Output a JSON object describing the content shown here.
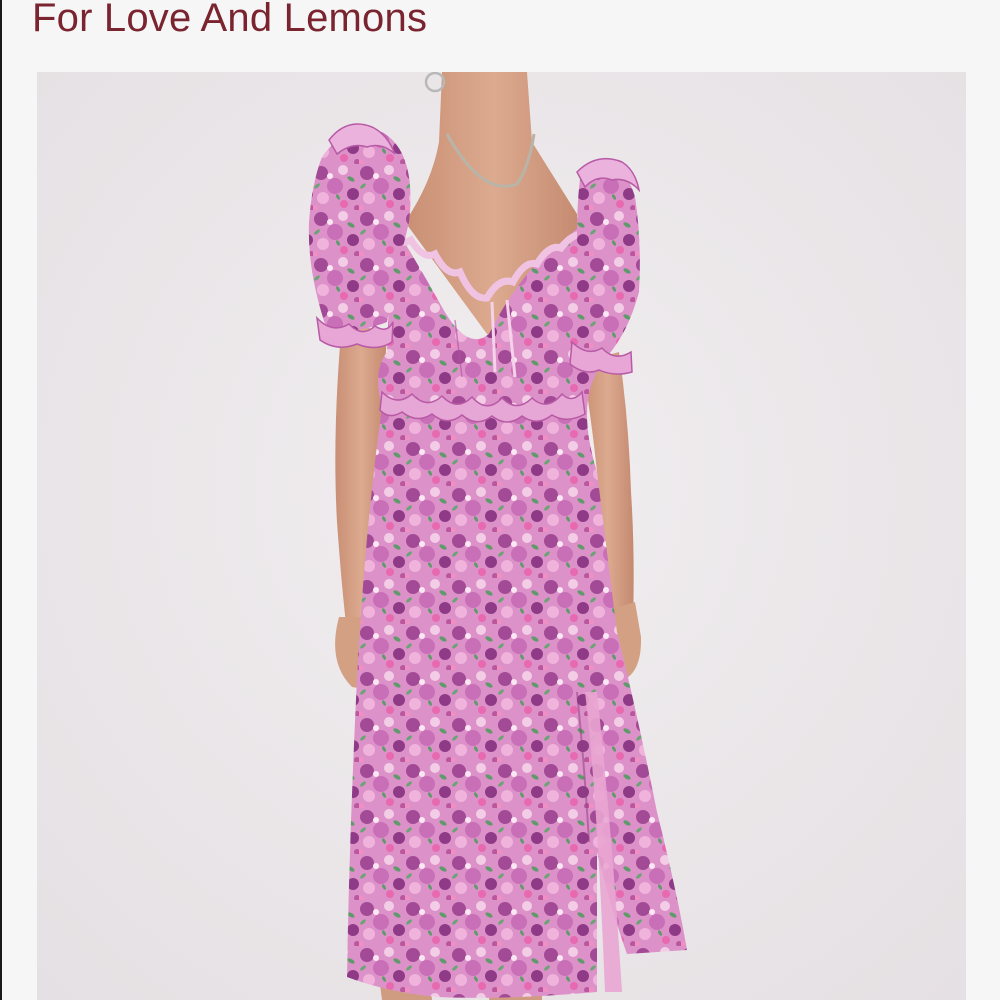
{
  "listing": {
    "brand": "For Love And Lemons"
  },
  "product_image": {
    "alt": "Pink floral puff sleeve midi dress",
    "colors": {
      "background": "#ece8ea",
      "dress_base": "#d98ac6",
      "dress_dark": "#9b3f8f",
      "dress_light": "#f2c6e3",
      "leaf": "#5f9a6a",
      "skin": "#d9a78c"
    }
  }
}
